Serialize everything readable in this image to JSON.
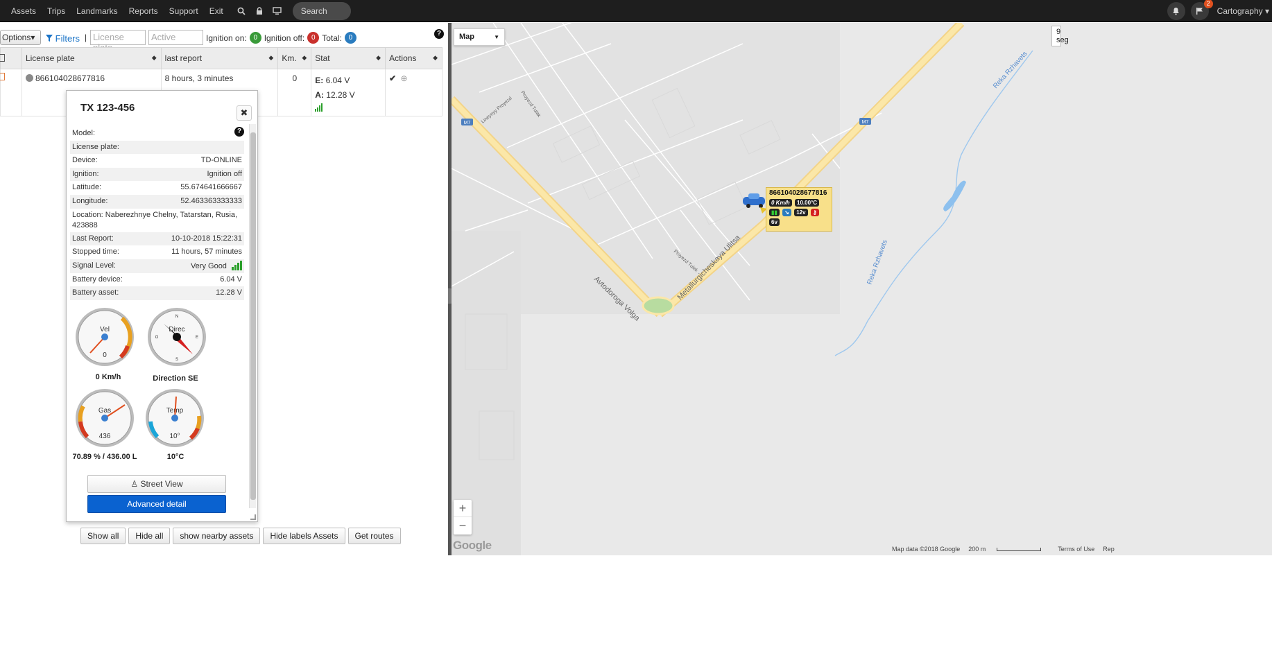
{
  "topnav": {
    "items": [
      "Assets",
      "Trips",
      "Landmarks",
      "Reports",
      "Support",
      "Exit"
    ],
    "search_placeholder": "Search",
    "flag_badge": "2",
    "user_menu": "Cartography"
  },
  "toolbar": {
    "options_label": "Options▾",
    "filters_label": "Filters",
    "separator": "|",
    "plate_placeholder": "License plate",
    "status_placeholder": "Active",
    "ignition_on_label": "Ignition on:",
    "ignition_on_count": "0",
    "ignition_off_label": "Ignition off:",
    "ignition_off_count": "0",
    "total_label": "Total:",
    "total_count": "0"
  },
  "grid": {
    "headers": [
      "License plate",
      "last report",
      "Km.",
      "Stat",
      "Actions"
    ],
    "row": {
      "plate": "866104028677816",
      "last_report": "8 hours, 3 minutes",
      "km": "0",
      "stat_e_label": "E:",
      "stat_e": "6.04 V",
      "stat_a_label": "A:",
      "stat_a": "12.28 V"
    }
  },
  "popup": {
    "title": "TX 123-456",
    "rows": [
      {
        "k": "Model:",
        "v": ""
      },
      {
        "k": "License plate:",
        "v": ""
      },
      {
        "k": "Device:",
        "v": "TD-ONLINE"
      },
      {
        "k": "Ignition:",
        "v": "Ignition off"
      },
      {
        "k": "Latitude:",
        "v": "55.674641666667"
      },
      {
        "k": "Longitude:",
        "v": "52.463363333333"
      },
      {
        "k": "Location: Naberezhnye Chelny, Tatarstan, Rusia, 423888",
        "v": ""
      },
      {
        "k": "Last Report:",
        "v": "10-10-2018 15:22:31"
      },
      {
        "k": "Stopped time:",
        "v": "11 hours, 57 minutes"
      },
      {
        "k": "Signal Level:",
        "v": "Very Good"
      },
      {
        "k": "Battery device:",
        "v": "6.04 V"
      },
      {
        "k": "Battery asset:",
        "v": "12.28 V"
      }
    ],
    "gauges": {
      "speed_label": "Vel",
      "speed_value": "0",
      "speed_caption": "0 Km/h",
      "dir_label": "Direc",
      "dir_caption": "Direction SE",
      "gas_label": "Gas",
      "gas_value": "436",
      "gas_caption": "70.89 % / 436.00 L",
      "temp_label": "Temp",
      "temp_value": "10°",
      "temp_caption": "10°C"
    },
    "street_view": "Street View",
    "advanced": "Advanced detail"
  },
  "bottom_buttons": [
    "Show all",
    "Hide all",
    "show nearby assets",
    "Hide labels Assets",
    "Get routes"
  ],
  "map": {
    "type_label": "Map",
    "refresh": "9 seg",
    "vehicle": {
      "plate": "866104028677816",
      "speed": "0 Km/h",
      "temp": "10.00°C",
      "battery_asset": "12v",
      "battery_device": "6v"
    },
    "labels": {
      "road_volga": "Avtodoroga Volga",
      "road_metal": "Metallurgicheskaya Ulitsa",
      "river": "Reka Rzhavets",
      "m7": "M7",
      "proezd1": "Proyezd Tulak",
      "proezd2": "Lineynyy Proyezd",
      "proezd3": "Proyezd Tulek"
    },
    "attribution": "Map data ©2018 Google",
    "scale": "200 m",
    "terms": "Terms of Use",
    "report": "Rep",
    "google": "Google"
  }
}
